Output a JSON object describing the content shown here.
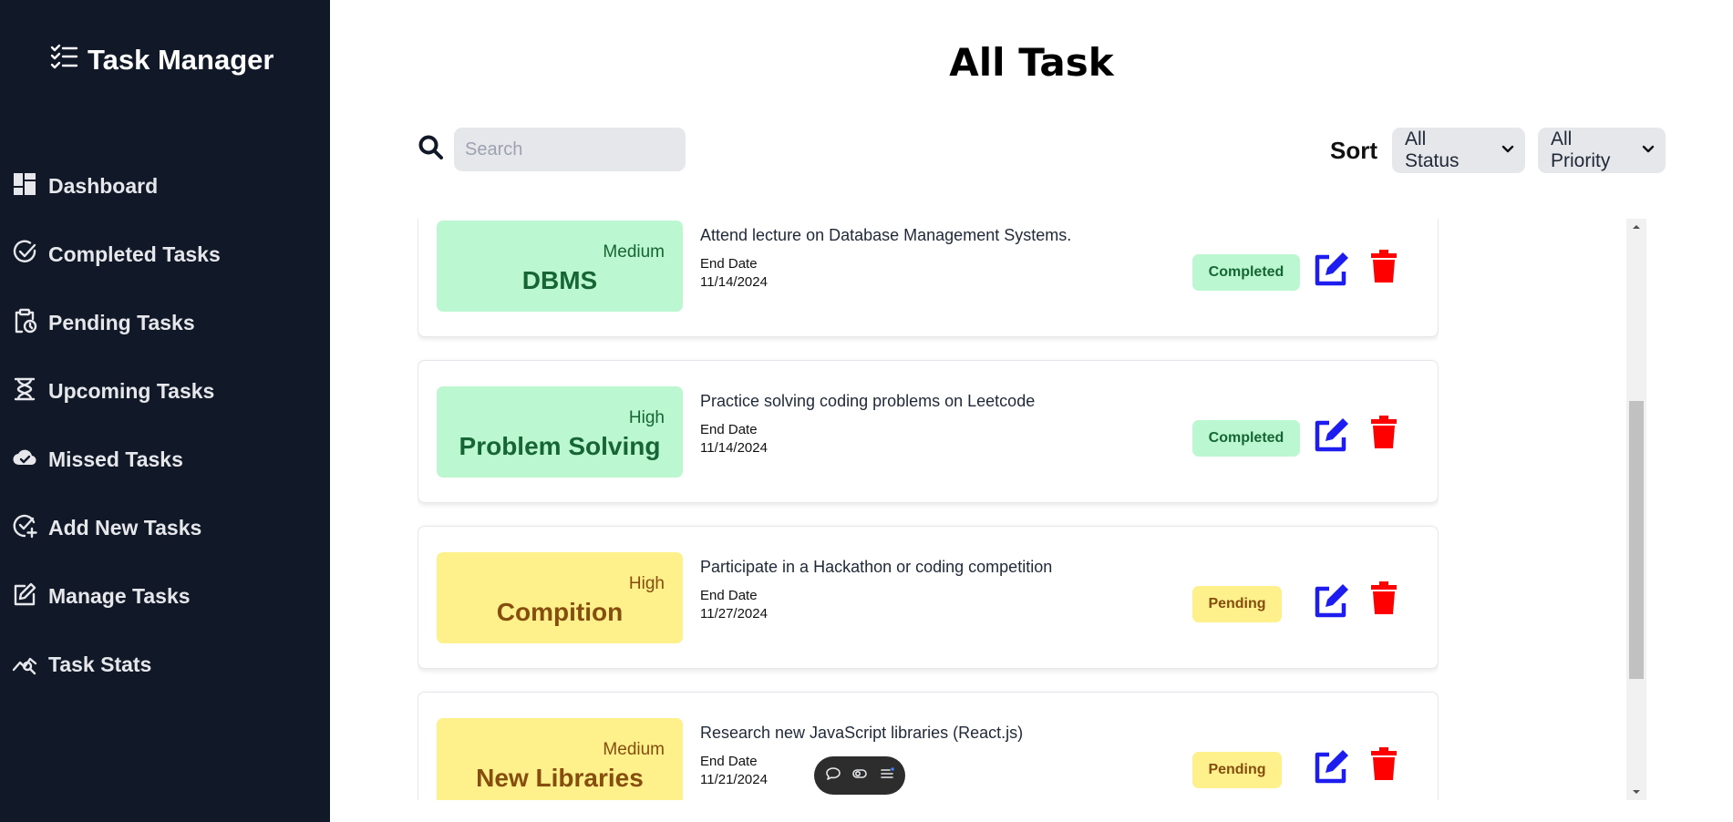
{
  "app": {
    "title": "Task Manager"
  },
  "sidebar": {
    "items": [
      {
        "label": "Dashboard",
        "icon": "dashboard-icon"
      },
      {
        "label": "Completed Tasks",
        "icon": "check-circle-icon"
      },
      {
        "label": "Pending Tasks",
        "icon": "clipboard-clock-icon"
      },
      {
        "label": "Upcoming Tasks",
        "icon": "hourglass-icon"
      },
      {
        "label": "Missed Tasks",
        "icon": "cloud-check-icon"
      },
      {
        "label": "Add New Tasks",
        "icon": "add-check-icon"
      },
      {
        "label": "Manage Tasks",
        "icon": "edit-icon"
      },
      {
        "label": "Task Stats",
        "icon": "stats-icon"
      }
    ]
  },
  "main": {
    "title": "All Task",
    "search": {
      "placeholder": "Search",
      "value": ""
    },
    "sort": {
      "label": "Sort",
      "status_selected": "All Status",
      "priority_selected": "All Priority"
    },
    "end_date_label": "End Date",
    "tasks": [
      {
        "name": "DBMS",
        "priority": "Medium",
        "description": "Attend lecture on Database Management Systems.",
        "end_date": "11/14/2024",
        "status": "Completed"
      },
      {
        "name": "Problem Solving",
        "priority": "High",
        "description": "Practice solving coding problems on Leetcode",
        "end_date": "11/14/2024",
        "status": "Completed"
      },
      {
        "name": "Compition",
        "priority": "High",
        "description": "Participate in a Hackathon or coding competition",
        "end_date": "11/27/2024",
        "status": "Pending"
      },
      {
        "name": "New Libraries",
        "priority": "Medium",
        "description": "Research new JavaScript libraries (React.js)",
        "end_date": "11/21/2024",
        "status": "Pending"
      }
    ]
  },
  "colors": {
    "sidebar_bg": "#111827",
    "completed_bg": "#bbf7d0",
    "completed_text": "#166534",
    "pending_bg": "#fef08a",
    "pending_text": "#854d0e",
    "edit_icon": "#1d1df0",
    "delete_icon": "#ff0000"
  }
}
